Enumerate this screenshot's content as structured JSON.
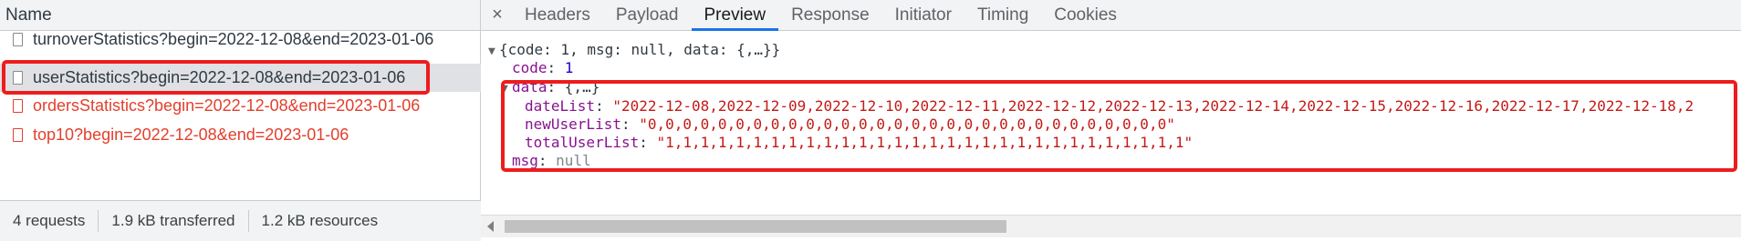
{
  "network": {
    "header": "Name",
    "requests": [
      {
        "name": "turnoverStatistics?begin=2022-12-08&end=2023-01-06",
        "status": "ok"
      },
      {
        "name": "userStatistics?begin=2022-12-08&end=2023-01-06",
        "status": "ok",
        "selected": true
      },
      {
        "name": "ordersStatistics?begin=2022-12-08&end=2023-01-06",
        "status": "error"
      },
      {
        "name": "top10?begin=2022-12-08&end=2023-01-06",
        "status": "error"
      }
    ],
    "footer": {
      "requests": "4 requests",
      "transferred": "1.9 kB transferred",
      "resources": "1.2 kB resources"
    }
  },
  "detail": {
    "close_label": "×",
    "tabs": [
      "Headers",
      "Payload",
      "Preview",
      "Response",
      "Initiator",
      "Timing",
      "Cookies"
    ],
    "active_tab": "Preview",
    "preview": {
      "root_summary": "{code: 1, msg: null, data: {,…}}",
      "code_key": "code",
      "code_value": "1",
      "data_key": "data",
      "data_summary": "{,…}",
      "date_list_key": "dateList",
      "date_list_value": "\"2022-12-08,2022-12-09,2022-12-10,2022-12-11,2022-12-12,2022-12-13,2022-12-14,2022-12-15,2022-12-16,2022-12-17,2022-12-18,2",
      "new_user_list_key": "newUserList",
      "new_user_list_value": "\"0,0,0,0,0,0,0,0,0,0,0,0,0,0,0,0,0,0,0,0,0,0,0,0,0,0,0,0,0,0\"",
      "total_user_list_key": "totalUserList",
      "total_user_list_value": "\"1,1,1,1,1,1,1,1,1,1,1,1,1,1,1,1,1,1,1,1,1,1,1,1,1,1,1,1,1,1\"",
      "msg_key": "msg",
      "msg_value": "null"
    }
  },
  "colors": {
    "highlight": "#ee1c1c",
    "error_text": "#e33f2c",
    "active_tab_underline": "#1a73e8"
  }
}
